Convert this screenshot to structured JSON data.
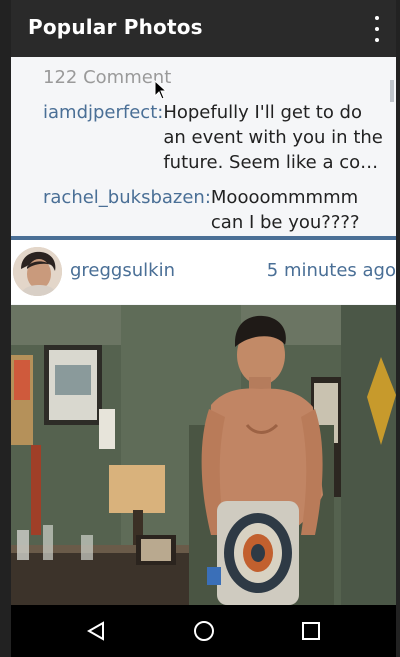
{
  "app_bar": {
    "title": "Popular Photos",
    "overflow_icon": "more-vert-icon"
  },
  "comments": {
    "count_label": "122 Comment",
    "items": [
      {
        "user": "iamdjperfect:",
        "text": "Hopefully I'll get to do an event with you in the future. Seem like a co…"
      },
      {
        "user": "rachel_buksbazen:",
        "text": "Moooommmmm can I be you????"
      }
    ]
  },
  "post": {
    "username": "greggsulkin",
    "time": "5 minutes ago",
    "avatar_icon": "avatar",
    "photo_icon": "photo"
  },
  "nav": {
    "back_icon": "back-icon",
    "home_icon": "home-icon",
    "recents_icon": "recents-icon"
  },
  "colors": {
    "accent": "#4a6f96",
    "app_bar": "#2a2a2a",
    "background": "#f5f6f8",
    "nav_bar": "#000000"
  }
}
